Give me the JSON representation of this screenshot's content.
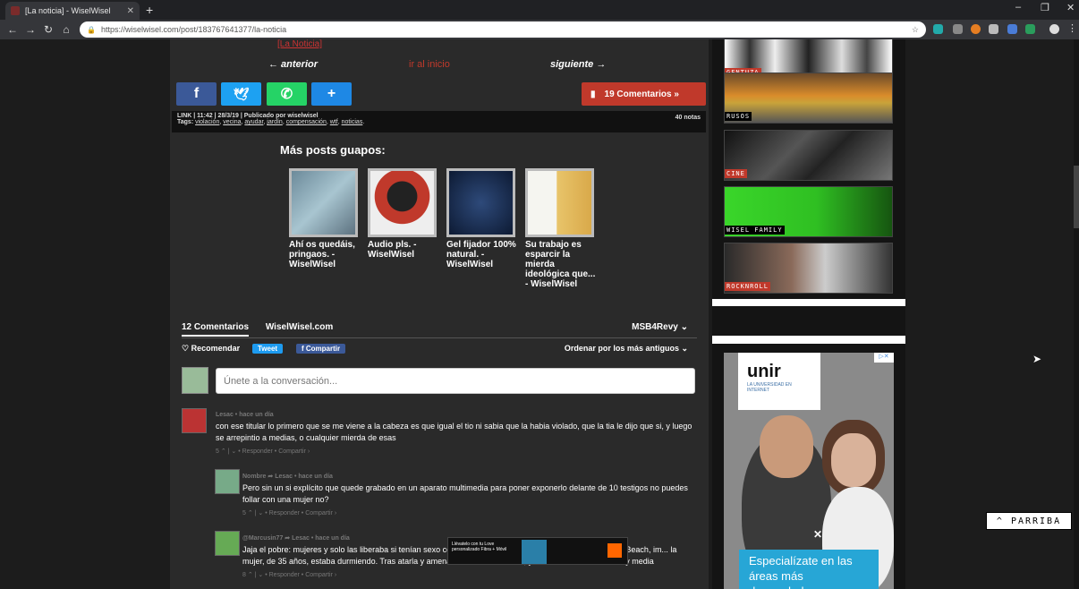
{
  "browser": {
    "tab_title": "[La noticia] - WiselWisel",
    "tab_close": "✕",
    "new_tab": "+",
    "url": "https://wiselwisel.com/post/183767641377/la-noticia",
    "win_min": "–",
    "win_max": "❐",
    "win_close": "✕"
  },
  "post": {
    "top_note": "[La Noticia]",
    "prev_label": "← anterior",
    "home_label": "ir al inicio",
    "next_label": "siguiente →",
    "comments_button": "19 Comentarios  »",
    "meta_line1": "LINK | 11:42 | 28/3/19 | Publicado por wiselwisel",
    "meta_tags_prefix": "Tags: ",
    "tags": [
      "violación",
      "vecina",
      "ayudar",
      "jardín",
      "compensación",
      "wtf",
      "noticias"
    ],
    "notes": "40 notas",
    "more_title": "Más posts guapos:",
    "related": [
      {
        "caption": "Ahí os quedáis, pringaos. - WiselWisel"
      },
      {
        "caption": "Audio pls. - WiselWisel"
      },
      {
        "caption": "Gel fijador 100% natural. - WiselWisel"
      },
      {
        "caption": "Su trabajo es esparcir la mierda ideológica que... - WiselWisel"
      }
    ]
  },
  "disqus": {
    "count": "12 Comentarios",
    "site": "WiselWisel.com",
    "user": "MSB4Revy ⌄",
    "recommend": "♡ Recomendar",
    "tweet": "Tweet",
    "share": "f Compartir",
    "sort": "Ordenar por los más antiguos ⌄",
    "placeholder": "Únete a la conversación...",
    "comments": [
      {
        "author": "Lesac • hace un día",
        "text": "con ese titular lo primero que se me viene a la cabeza es que igual el tio ni sabia que la habia violado, que la tia le dijo que si, y luego se arrepintio a medias, o cualquier mierda de esas",
        "actions": "5 ⌃ | ⌄ • Responder • Compartir ›"
      },
      {
        "author": "Nombre ➦ Lesac • hace un día",
        "text": "Pero sin un si explícito que quede grabado en un aparato multimedia para poner exponerlo delante de 10 testigos no puedes follar con una mujer no?",
        "actions": "5 ⌃ | ⌄ • Responder • Compartir ›"
      },
      {
        "author": "@Marcusin77 ➦ Lesac • hace un día",
        "text": "Jaja el pobre: mujeres y solo las liberaba si tenían sexo con él. Walding, residente en la ciudad de Boynton Beach, im... la mujer, de 35 años, estaba durmiendo. Tras atarla y amenazarla con un cuchillo, y la violó durante una hora y media",
        "actions": "8 ⌃ | ⌄ • Responder • Compartir ›"
      }
    ],
    "ad_text": "Llévatelo con tu Love personalizado Fibra + Móvil"
  },
  "sidebar": {
    "categories": [
      "GENTUZA",
      "RUSOS",
      "CINE",
      "WISEL FAMILY",
      "ROCKNROLL"
    ],
    "ad_brand": "unir",
    "ad_brand_sub": "LA UNIVERSIDAD EN INTERNET",
    "ad_banner": "Especialízate en las áreas más demandadas",
    "ad_close": "✕",
    "ad_x": "▷✕"
  },
  "back_top": "^ PARRIBA",
  "colors": {
    "accent": "#c0392b",
    "facebook": "#3b5998",
    "twitter": "#1da1f2",
    "whatsapp": "#25d366",
    "plus": "#1e88e5"
  }
}
